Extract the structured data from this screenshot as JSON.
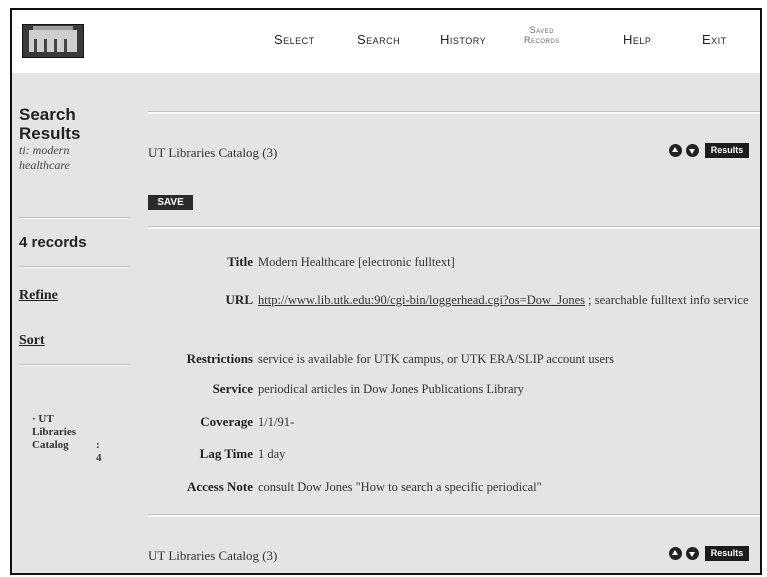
{
  "nav": {
    "select": "Select",
    "search": "Search",
    "history": "History",
    "saved_line1": "Saved",
    "saved_line2": "Records",
    "help": "Help",
    "exit": "Exit"
  },
  "sidebar": {
    "title_line1": "Search",
    "title_line2": "Results",
    "query_line1": "ti: modern",
    "query_line2": "healthcare",
    "count": "4 records",
    "refine": "Refine",
    "sort": "Sort",
    "catalog_bullet": "·",
    "catalog_line1": "UT",
    "catalog_line2": "Libraries",
    "catalog_line3": "Catalog",
    "catalog_count": ": 4"
  },
  "sections": [
    {
      "title": "UT Libraries Catalog (3)",
      "results_label": "Results"
    },
    {
      "title": "UT Libraries Catalog (3)",
      "results_label": "Results"
    }
  ],
  "save_label": "SAVE",
  "record": {
    "title_label": "Title",
    "title_value": "Modern Healthcare [electronic fulltext]",
    "url_label": "URL",
    "url_link": "http://www.lib.utk.edu:90/cgi-bin/loggerhead.cgi?os=Dow_Jones",
    "url_suffix": " ; searchable fulltext info service",
    "restrictions_label": "Restrictions",
    "restrictions_value": "service is available for UTK campus, or UTK ERA/SLIP account users",
    "service_label": "Service",
    "service_value": "periodical articles in Dow Jones Publications Library",
    "coverage_label": "Coverage",
    "coverage_value": "1/1/91-",
    "lag_label": "Lag Time",
    "lag_value": "1 day",
    "access_label": "Access Note",
    "access_value": "consult Dow Jones \"How to search a specific periodical\""
  }
}
